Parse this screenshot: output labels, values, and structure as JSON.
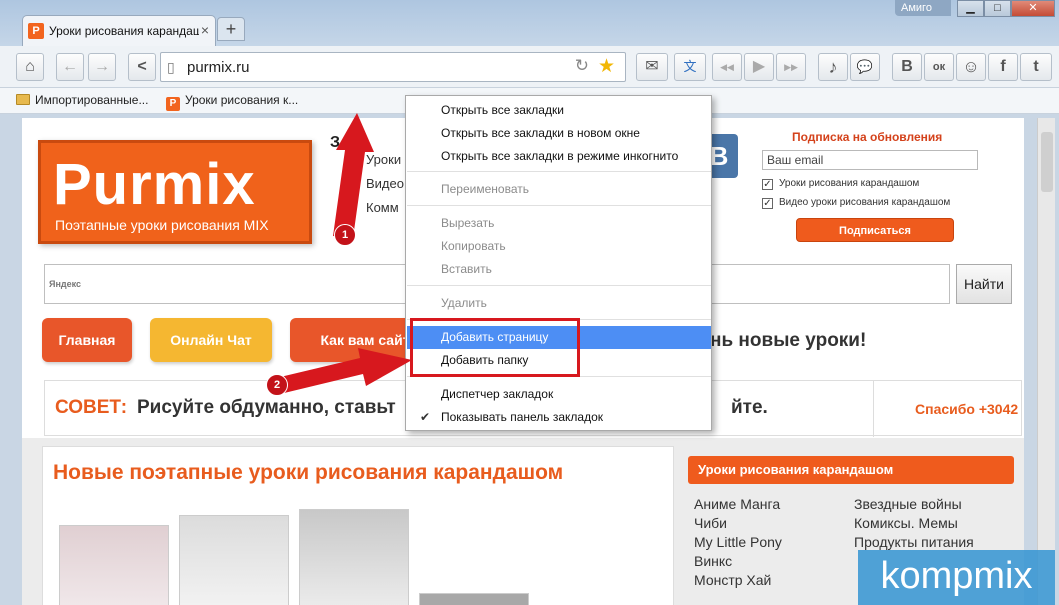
{
  "window": {
    "tab_title": "Уроки рисования карандаш",
    "tab_favicon": "P",
    "profile": "Амиго",
    "min_glyph": "▁",
    "max_glyph": "□",
    "close_glyph": "✕",
    "tab_close": "×",
    "new_tab": "+"
  },
  "toolbar": {
    "url": "purmix.ru",
    "icons": {
      "home": "⌂",
      "back": "←",
      "forward": "→",
      "share": "<",
      "reload": "↻",
      "star": "★",
      "mail": "✉",
      "translate": "文",
      "prev": "◀◀",
      "play": "▶",
      "next": "▶▶",
      "music": "♪",
      "chat": "💬",
      "vk": "B",
      "ok": "ок",
      "smile": "☺",
      "facebook": "f",
      "twitter": "t"
    }
  },
  "bookmarks": [
    {
      "label": "Импортированные..."
    },
    {
      "label": "Уроки рисования к..."
    }
  ],
  "page": {
    "logo_big": "Purmix",
    "logo_sub": "Поэтапные уроки рисования MIX",
    "mid_title": "З",
    "mid_links": [
      "Уроки",
      "Видео",
      "Комм"
    ],
    "vk_letter": "B",
    "subscribe": {
      "title": "Подписка на обновления",
      "email_placeholder": "Ваш email",
      "options": [
        "Уроки рисования карандашом",
        "Видео уроки рисования карандашом"
      ],
      "button": "Подписаться"
    },
    "search": {
      "engine_label": "Яндекс",
      "button": "Найти"
    },
    "nav": [
      {
        "label": "Главная",
        "color": "#e8562a"
      },
      {
        "label": "Онлайн Чат",
        "color": "#f5b731"
      },
      {
        "label": "Как вам сайт",
        "color": "#e8562a"
      }
    ],
    "daily_text": "нь новые уроки!",
    "advice": {
      "label": "СОВЕТ:",
      "text": "Рисуйте обдуманно, ставьт",
      "text_end": "йте.",
      "thanks": "Спасибо +3042"
    },
    "lessons_title": "Новые поэтапные уроки рисования карандашом",
    "sidebar": {
      "title": "Уроки рисования карандашом",
      "col1": [
        "Аниме Манга",
        "Чиби",
        "My Little Pony",
        "Винкс",
        "Монстр Хай"
      ],
      "col2": [
        "Звездные войны",
        "Комиксы. Мемы",
        "Продукты питания"
      ]
    }
  },
  "context_menu": {
    "items": [
      {
        "label": "Открыть все закладки",
        "enabled": true
      },
      {
        "label": "Открыть все закладки в новом окне",
        "enabled": true
      },
      {
        "label": "Открыть все закладки в режиме инкогнито",
        "enabled": true
      },
      {
        "label": "Переименовать",
        "enabled": false
      },
      {
        "label": "Вырезать",
        "enabled": false
      },
      {
        "label": "Копировать",
        "enabled": false
      },
      {
        "label": "Вставить",
        "enabled": false
      },
      {
        "label": "Удалить",
        "enabled": false
      },
      {
        "label": "Добавить страницу",
        "enabled": true,
        "highlighted": true
      },
      {
        "label": "Добавить папку",
        "enabled": true
      },
      {
        "label": "Диспетчер закладок",
        "enabled": true
      },
      {
        "label": "Показывать панель закладок",
        "enabled": true,
        "checked": true
      }
    ],
    "check_glyph": "✔"
  },
  "annotations": {
    "step1": "1",
    "step2": "2",
    "arrow_color": "#d7181e"
  },
  "watermark": "kompmix"
}
